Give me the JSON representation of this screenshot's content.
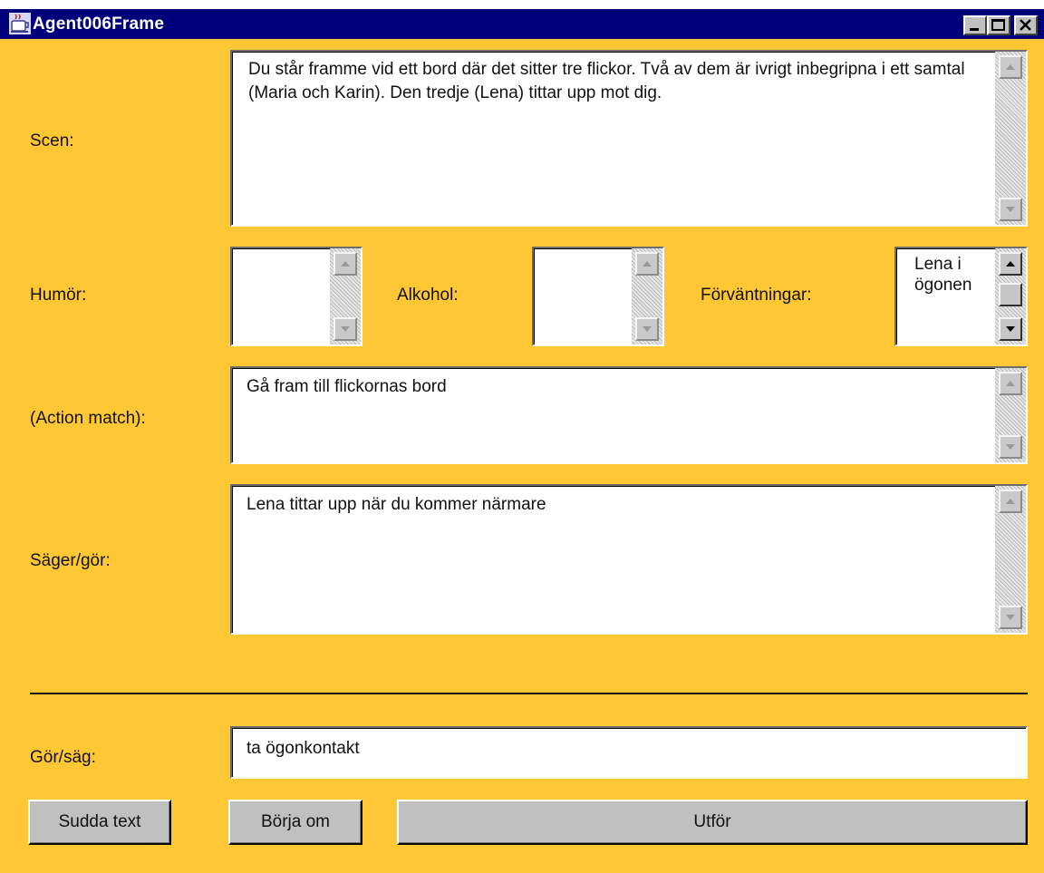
{
  "window": {
    "title": "Agent006Frame",
    "icon": "java-cup-icon",
    "controls": [
      "minimize",
      "maximize",
      "close"
    ]
  },
  "labels": {
    "scen": "Scen:",
    "humor": "Humör:",
    "alkohol": "Alkohol:",
    "forvantningar": "Förväntningar:",
    "action_match": "(Action match):",
    "sager_gor": "Säger/gör:",
    "gor_sag": "Gör/säg:"
  },
  "fields": {
    "scen": "Du står framme vid ett bord där det sitter tre flickor. Två av dem är ivrigt inbegripna i ett samtal (Maria och Karin). Den tredje (Lena) tittar upp mot dig.",
    "humor": "",
    "alkohol": "",
    "forvantningar": "Lena i ögonen",
    "action_match": "Gå fram till flickornas bord",
    "sager_gor": "Lena tittar upp när du kommer närmare",
    "gor_sag_value": "ta ögonkontakt"
  },
  "buttons": {
    "sudda_text": "Sudda text",
    "borja_om": "Börja om",
    "utfor": "Utför"
  },
  "colors": {
    "window_background": "#fec733",
    "titlebar": "#00007b",
    "button_face": "#c0c0c0"
  }
}
